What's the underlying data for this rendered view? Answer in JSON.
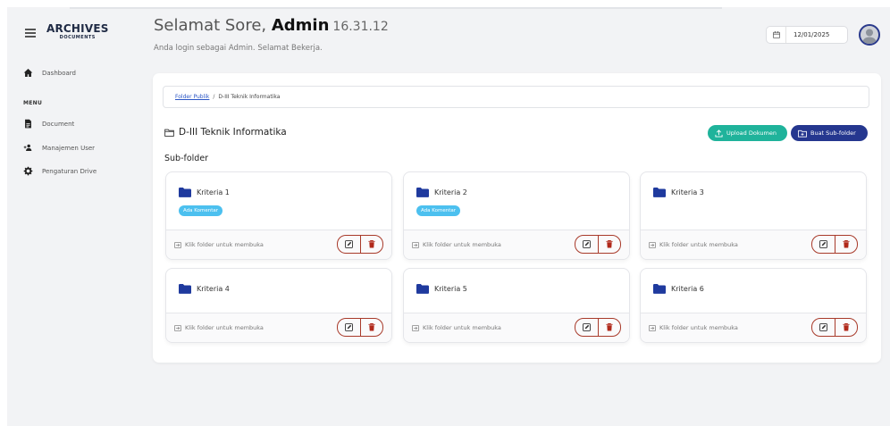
{
  "sidebar": {
    "logo_title": "ARCHIVES",
    "logo_sub": "DOCUMENTS",
    "menu_label": "MENU",
    "items": [
      {
        "label": "Dashboard",
        "icon": "home-icon"
      },
      {
        "label": "Document",
        "icon": "file-icon"
      },
      {
        "label": "Manajemen User",
        "icon": "users-icon"
      },
      {
        "label": "Pengaturan Drive",
        "icon": "gear-icon"
      }
    ]
  },
  "header": {
    "greeting_prefix": "Selamat Sore, ",
    "user_name": "Admin",
    "time": "16.31.12",
    "subtitle": "Anda login sebagai Admin. Selamat Bekerja.",
    "date": "12/01/2025"
  },
  "main": {
    "breadcrumb": {
      "root": "Folder Publik",
      "separator": "/",
      "current": "D-III Teknik Informatika"
    },
    "folder_title": "D-III Teknik Informatika",
    "upload_button": "Upload Dokumen",
    "subfolder_button": "Buat Sub-folder",
    "subfolder_label": "Sub-folder",
    "folders": [
      {
        "name": "Kriteria 1",
        "badge": "Ada Komentar",
        "hint": "Klik folder untuk membuka"
      },
      {
        "name": "Kriteria 2",
        "badge": "Ada Komentar",
        "hint": "Klik folder untuk membuka"
      },
      {
        "name": "Kriteria 3",
        "hint": "Klik folder untuk membuka"
      },
      {
        "name": "Kriteria 4",
        "hint": "Klik folder untuk membuka"
      },
      {
        "name": "Kriteria 5",
        "hint": "Klik folder untuk membuka"
      },
      {
        "name": "Kriteria 6",
        "hint": "Klik folder untuk membuka"
      }
    ]
  },
  "colors": {
    "brand": "#25378f",
    "upload": "#1fb39b",
    "folder": "#1f3a9e",
    "badge": "#4cc0ef",
    "danger": "#a83a2a"
  }
}
